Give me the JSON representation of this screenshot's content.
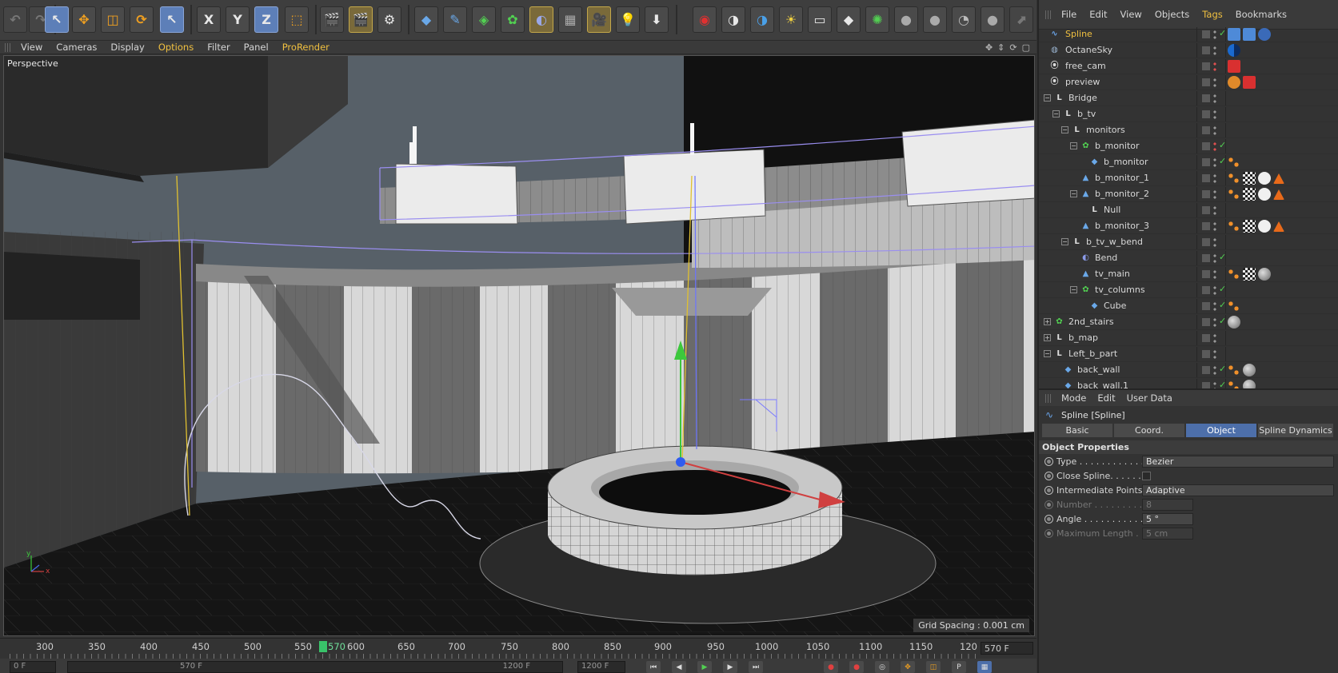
{
  "toolbar": {
    "axis_x": "X",
    "axis_y": "Y",
    "axis_z": "Z"
  },
  "viewport_menu": {
    "items": [
      "View",
      "Cameras",
      "Display",
      "Options",
      "Filter",
      "Panel",
      "ProRender"
    ]
  },
  "viewport": {
    "name": "Perspective",
    "grid_spacing": "Grid Spacing : 0.001 cm",
    "axis_y": "y",
    "axis_x": "x"
  },
  "timeline": {
    "ticks": [
      "300",
      "350",
      "400",
      "450",
      "500",
      "550",
      "570",
      "600",
      "650",
      "700",
      "750",
      "800",
      "850",
      "900",
      "950",
      "1000",
      "1050",
      "1100",
      "1150",
      "120"
    ],
    "current_frame": "570",
    "frame_field": "570 F",
    "bottom_fields": [
      "0 F",
      "570 F",
      "1200 F",
      "1200 F"
    ]
  },
  "object_manager": {
    "menu": [
      "File",
      "Edit",
      "View",
      "Objects",
      "Tags",
      "Bookmarks"
    ],
    "rows": [
      {
        "name": "Spline",
        "icon": "spline",
        "selected": true
      },
      {
        "name": "OctaneSky",
        "icon": "sky"
      },
      {
        "name": "free_cam",
        "icon": "cam"
      },
      {
        "name": "preview",
        "icon": "cam"
      },
      {
        "name": "Bridge",
        "icon": "null"
      },
      {
        "name": "b_tv",
        "icon": "null"
      },
      {
        "name": "monitors",
        "icon": "null"
      },
      {
        "name": "b_monitor",
        "icon": "cloner"
      },
      {
        "name": "b_monitor",
        "icon": "cube"
      },
      {
        "name": "b_monitor_1",
        "icon": "poly"
      },
      {
        "name": "b_monitor_2",
        "icon": "poly"
      },
      {
        "name": "Null",
        "icon": "null"
      },
      {
        "name": "b_monitor_3",
        "icon": "poly"
      },
      {
        "name": "b_tv_w_bend",
        "icon": "null"
      },
      {
        "name": "Bend",
        "icon": "deformer"
      },
      {
        "name": "tv_main",
        "icon": "poly"
      },
      {
        "name": "tv_columns",
        "icon": "cloner"
      },
      {
        "name": "Cube",
        "icon": "cube"
      },
      {
        "name": "2nd_stairs",
        "icon": "cloner"
      },
      {
        "name": "b_map",
        "icon": "null"
      },
      {
        "name": "Left_b_part",
        "icon": "null"
      },
      {
        "name": "back_wall",
        "icon": "cube"
      },
      {
        "name": "back_wall.1",
        "icon": "cube"
      }
    ]
  },
  "attribute_manager": {
    "menu": [
      "Mode",
      "Edit",
      "User Data"
    ],
    "title": "Spline [Spline]",
    "tabs": [
      "Basic",
      "Coord.",
      "Object",
      "Spline Dynamics"
    ],
    "active_tab": "Object",
    "section": "Object Properties",
    "props": [
      {
        "label": "Type . . . . . . . . . . . .",
        "value": "Bezier",
        "kind": "dropdown"
      },
      {
        "label": "Close Spline. . . . . .",
        "value": "",
        "kind": "checkbox"
      },
      {
        "label": "Intermediate Points",
        "value": "Adaptive",
        "kind": "dropdown"
      },
      {
        "label": "Number . . . . . . . . .",
        "value": "8",
        "kind": "number",
        "disabled": true
      },
      {
        "label": "Angle . . . . . . . . . . .",
        "value": "5 °",
        "kind": "number"
      },
      {
        "label": "Maximum Length . .",
        "value": "5 cm",
        "kind": "number",
        "disabled": true
      }
    ]
  }
}
